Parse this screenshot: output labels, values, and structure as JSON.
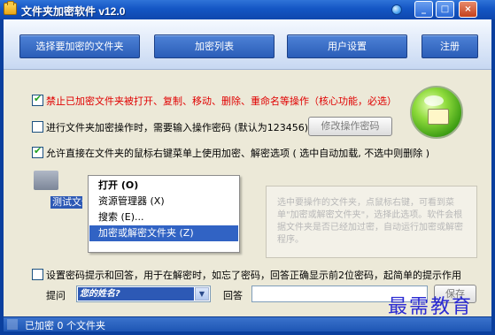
{
  "window": {
    "title": "文件夹加密软件 v12.0",
    "controls": {
      "minimize": "_",
      "maximize": "□",
      "close": "×"
    }
  },
  "toolbar": {
    "buttons": [
      "选择要加密的文件夹",
      "加密列表",
      "用户设置",
      "注册"
    ]
  },
  "options": {
    "forbid": {
      "checked": true,
      "label": "禁止已加密文件夹被打开、复制、移动、删除、重命名等操作（核心功能，必选）"
    },
    "require_password": {
      "checked": false,
      "label": "进行文件夹加密操作时，需要输入操作密码 (默认为123456)"
    },
    "modify_password_button": "修改操作密码",
    "context_menu": {
      "checked": true,
      "label": "允许直接在文件夹的鼠标右键菜单上使用加密、解密选项 ( 选中自动加载, 不选中则删除 )"
    }
  },
  "demo": {
    "folder_label": "测试文件夹",
    "menu_items": [
      "打开 (O)",
      "资源管理器 (X)",
      "搜索 (E)...",
      "加密或解密文件夹 (Z)"
    ],
    "hint": "选中要操作的文件夹，点鼠标右键，可看到菜单\"加密或解密文件夹\"，选择此选项。软件会根据文件夹是否已经加过密，自动运行加密或解密程序。"
  },
  "recovery": {
    "checked": false,
    "label": "设置密码提示和回答，用于在解密时，如忘了密码，回答正确显示前2位密码，起简单的提示作用",
    "question_label": "提问",
    "question_value": "您的姓名?",
    "answer_label": "回答",
    "save_button": "保存"
  },
  "watermark": "最需教育",
  "status": {
    "text": "已加密 0 个文件夹"
  },
  "colors": {
    "title_bar": "#1456c4",
    "button": "#2a5db8",
    "warning_text": "#e00000",
    "selection": "#3163c4"
  }
}
